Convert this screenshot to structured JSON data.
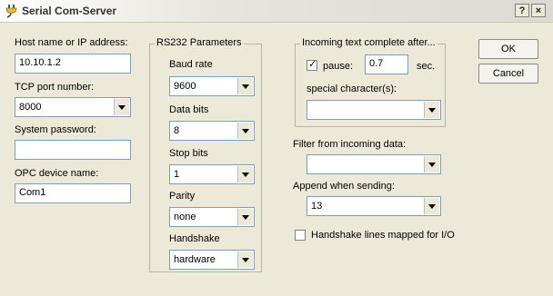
{
  "window": {
    "title": "Serial Com-Server",
    "help_button": "?",
    "close_button": "×"
  },
  "left": {
    "host_label": "Host name or IP address:",
    "host_value": "10.10.1.2",
    "tcp_label": "TCP port number:",
    "tcp_value": "8000",
    "password_label": "System password:",
    "password_value": "",
    "opc_label": "OPC device name:",
    "opc_value": "Com1"
  },
  "rs232": {
    "legend": "RS232 Parameters",
    "baud_label": "Baud rate",
    "baud_value": "9600",
    "databits_label": "Data bits",
    "databits_value": "8",
    "stopbits_label": "Stop bits",
    "stopbits_value": "1",
    "parity_label": "Parity",
    "parity_value": "none",
    "handshake_label": "Handshake",
    "handshake_value": "hardware"
  },
  "incoming": {
    "legend": "Incoming text complete after...",
    "pause_label": "pause:",
    "pause_checked": true,
    "pause_value": "0.7",
    "pause_unit": "sec.",
    "special_label": "special character(s):",
    "special_value": ""
  },
  "filter": {
    "label": "Filter from incoming data:",
    "value": ""
  },
  "append": {
    "label": "Append when sending:",
    "value": "13"
  },
  "handshake_lines": {
    "label": "Handshake lines mapped for I/O",
    "checked": false
  },
  "buttons": {
    "ok": "OK",
    "cancel": "Cancel"
  }
}
